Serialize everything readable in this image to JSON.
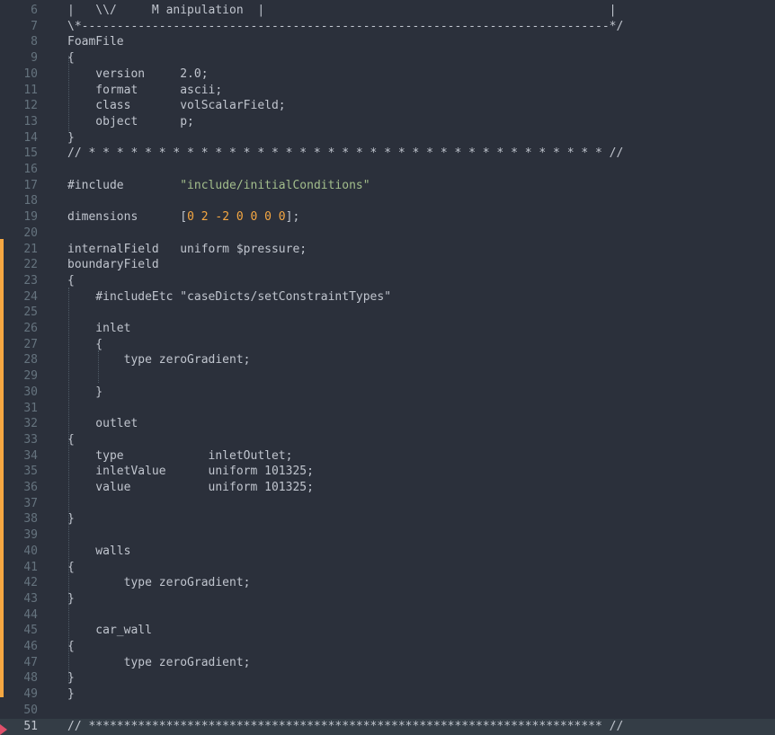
{
  "lines": [
    {
      "n": "6",
      "text": "|   \\\\/     M anipulation  |                                                 |"
    },
    {
      "n": "7",
      "text": "\\*---------------------------------------------------------------------------*/"
    },
    {
      "n": "8",
      "text": "FoamFile"
    },
    {
      "n": "9",
      "text": "{"
    },
    {
      "n": "10",
      "text": "    version     2.0;"
    },
    {
      "n": "11",
      "text": "    format      ascii;"
    },
    {
      "n": "12",
      "text": "    class       volScalarField;"
    },
    {
      "n": "13",
      "text": "    object      p;"
    },
    {
      "n": "14",
      "text": "}"
    },
    {
      "n": "15",
      "text": "// * * * * * * * * * * * * * * * * * * * * * * * * * * * * * * * * * * * * * //"
    },
    {
      "n": "16",
      "text": ""
    },
    {
      "n": "17",
      "text": "#include        ",
      "str": "\"include/initialConditions\""
    },
    {
      "n": "18",
      "text": ""
    },
    {
      "n": "19",
      "text": "dimensions      [",
      "nums": "0 2 -2 0 0 0 0",
      "tail": "];"
    },
    {
      "n": "20",
      "text": ""
    },
    {
      "n": "21",
      "text": "internalField   uniform $pressure;"
    },
    {
      "n": "22",
      "text": "boundaryField"
    },
    {
      "n": "23",
      "text": "{"
    },
    {
      "n": "24",
      "text": "    #includeEtc \"caseDicts/setConstraintTypes\""
    },
    {
      "n": "25",
      "text": ""
    },
    {
      "n": "26",
      "text": "    inlet"
    },
    {
      "n": "27",
      "text": "    {"
    },
    {
      "n": "28",
      "text": "        type zeroGradient;"
    },
    {
      "n": "29",
      "text": ""
    },
    {
      "n": "30",
      "text": "    }"
    },
    {
      "n": "31",
      "text": ""
    },
    {
      "n": "32",
      "text": "    outlet"
    },
    {
      "n": "33",
      "text": "{"
    },
    {
      "n": "34",
      "text": "    type            inletOutlet;"
    },
    {
      "n": "35",
      "text": "    inletValue      uniform 101325;"
    },
    {
      "n": "36",
      "text": "    value           uniform 101325;"
    },
    {
      "n": "37",
      "text": ""
    },
    {
      "n": "38",
      "text": "}"
    },
    {
      "n": "39",
      "text": ""
    },
    {
      "n": "40",
      "text": "    walls"
    },
    {
      "n": "41",
      "text": "{"
    },
    {
      "n": "42",
      "text": "        type zeroGradient;"
    },
    {
      "n": "43",
      "text": "}"
    },
    {
      "n": "44",
      "text": ""
    },
    {
      "n": "45",
      "text": "    car_wall"
    },
    {
      "n": "46",
      "text": "{"
    },
    {
      "n": "47",
      "text": "        type zeroGradient;"
    },
    {
      "n": "48",
      "text": "}"
    },
    {
      "n": "49",
      "text": "}"
    },
    {
      "n": "50",
      "text": ""
    },
    {
      "n": "51",
      "text": "// ************************************************************************* //"
    }
  ],
  "current_line": "51",
  "colors": {
    "background": "#2b303b",
    "line_number": "#65737e",
    "text": "#c0c5ce",
    "string": "#a3be8c",
    "number": "#f5a742",
    "modified_bar": "#f5a742",
    "error_marker": "#e0506b"
  }
}
